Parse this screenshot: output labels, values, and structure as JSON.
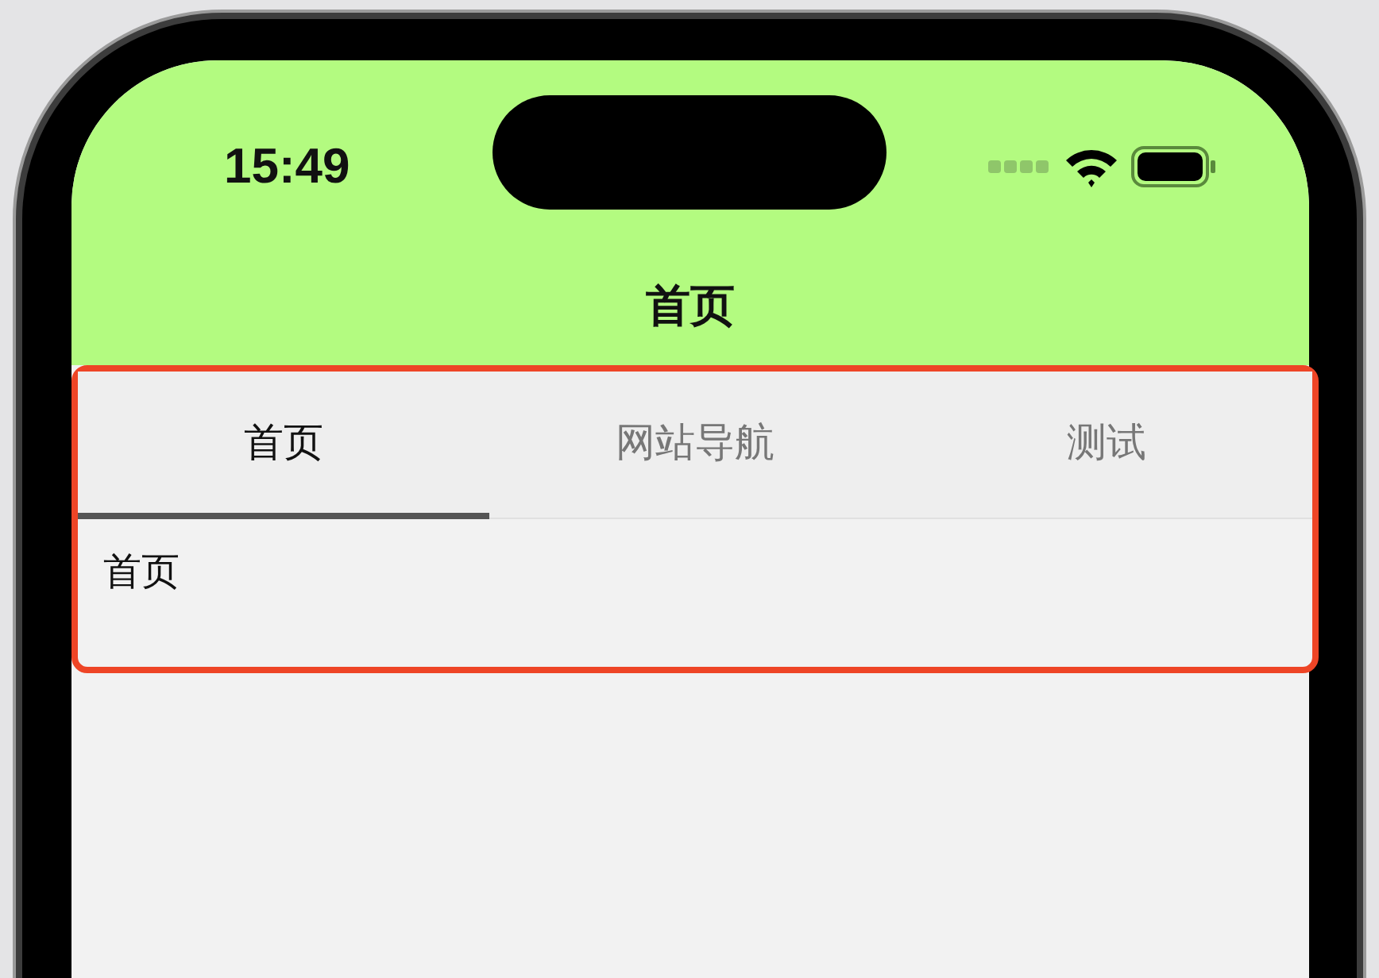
{
  "status_bar": {
    "time": "15:49"
  },
  "nav_bar": {
    "title": "首页"
  },
  "tabs": [
    {
      "label": "首页",
      "selected": true
    },
    {
      "label": "网站导航",
      "selected": false
    },
    {
      "label": "测试",
      "selected": false
    }
  ],
  "content": {
    "text": "首页"
  }
}
